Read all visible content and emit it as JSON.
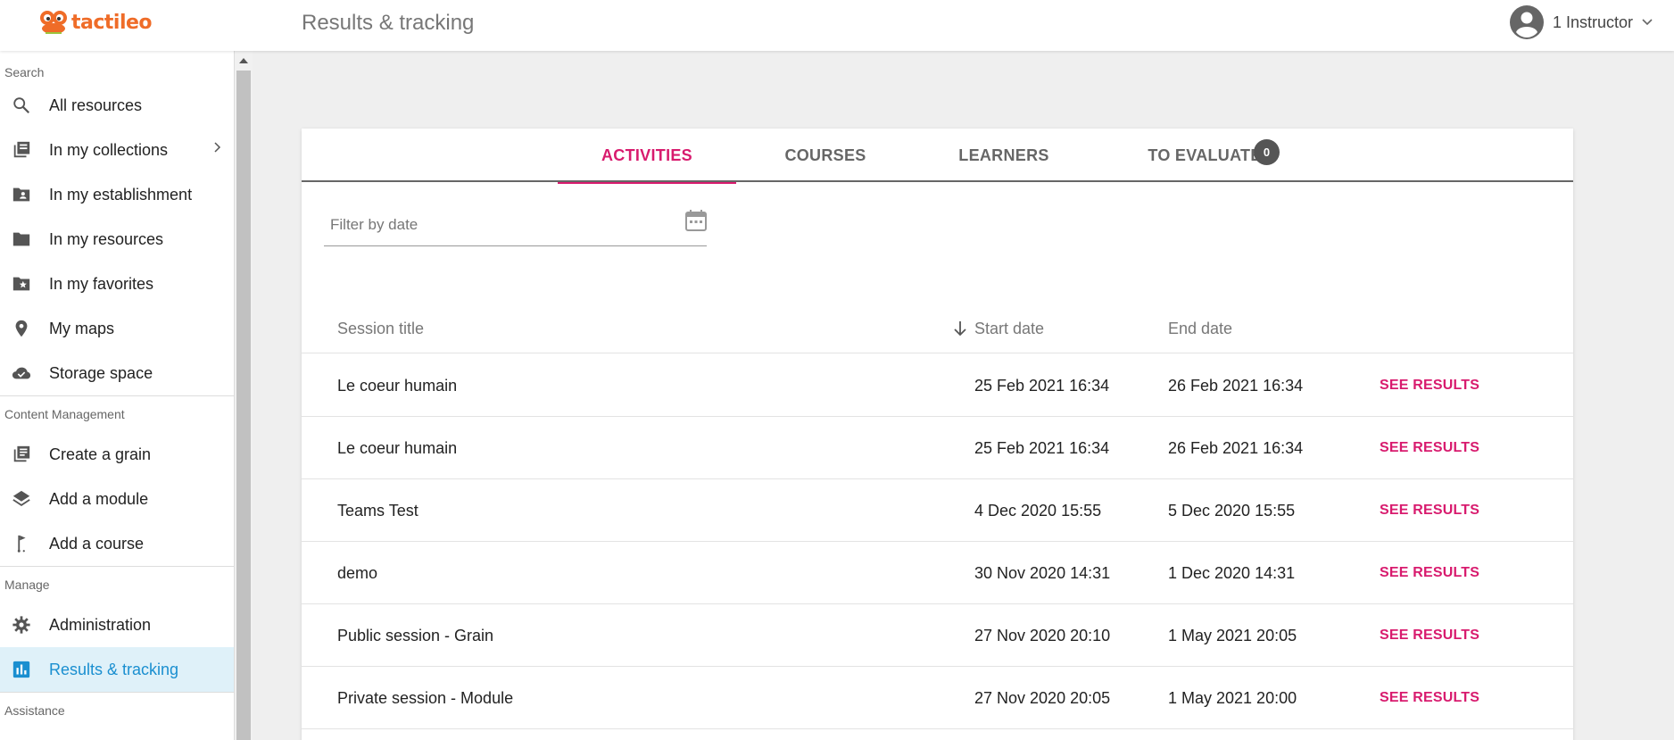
{
  "app": {
    "logo_text": "tactileo",
    "title": "Results & tracking"
  },
  "user": {
    "name": "1 Instructor"
  },
  "sidebar": {
    "sections": [
      {
        "label": "Search"
      },
      {
        "label": "Content Management"
      },
      {
        "label": "Manage"
      },
      {
        "label": "Assistance"
      }
    ],
    "items": [
      {
        "label": "All resources",
        "icon": "search-icon"
      },
      {
        "label": "In my collections",
        "icon": "collections-icon"
      },
      {
        "label": "In my establishment",
        "icon": "establishment-folder-icon"
      },
      {
        "label": "In my resources",
        "icon": "folder-icon"
      },
      {
        "label": "In my favorites",
        "icon": "favorites-folder-icon"
      },
      {
        "label": "My maps",
        "icon": "map-pin-icon"
      },
      {
        "label": "Storage space",
        "icon": "cloud-check-icon"
      },
      {
        "label": "Create a grain",
        "icon": "grain-icon"
      },
      {
        "label": "Add a module",
        "icon": "layers-icon"
      },
      {
        "label": "Add a course",
        "icon": "course-flag-icon"
      },
      {
        "label": "Administration",
        "icon": "gear-icon"
      },
      {
        "label": "Results & tracking",
        "icon": "bar-chart-icon"
      }
    ]
  },
  "tabs": [
    {
      "label": "ACTIVITIES"
    },
    {
      "label": "COURSES"
    },
    {
      "label": "LEARNERS"
    },
    {
      "label": "TO EVALUATE",
      "badge": "0"
    }
  ],
  "filter": {
    "placeholder": "Filter by date",
    "value": ""
  },
  "table": {
    "columns": [
      "Session title",
      "Start date",
      "End date"
    ],
    "action_label": "SEE RESULTS",
    "rows": [
      {
        "title": "Le coeur humain",
        "start": "25 Feb 2021 16:34",
        "end": "26 Feb 2021 16:34"
      },
      {
        "title": "Le coeur humain",
        "start": "25 Feb 2021 16:34",
        "end": "26 Feb 2021 16:34"
      },
      {
        "title": "Teams Test",
        "start": "4 Dec 2020 15:55",
        "end": "5 Dec 2020 15:55"
      },
      {
        "title": "demo",
        "start": "30 Nov 2020 14:31",
        "end": "1 Dec 2020 14:31"
      },
      {
        "title": "Public session - Grain",
        "start": "27 Nov 2020 20:10",
        "end": "1 May 2021 20:05"
      },
      {
        "title": "Private session - Module",
        "start": "27 Nov 2020 20:05",
        "end": "1 May 2021 20:00"
      }
    ]
  },
  "colors": {
    "accent": "#d81b6e",
    "brand": "#ef6c28",
    "active_nav": "#1a8fd0"
  }
}
